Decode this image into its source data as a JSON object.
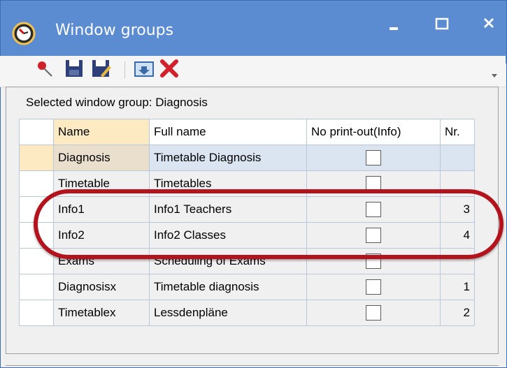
{
  "window": {
    "title": "Window groups",
    "accent_color": "#5b8cd1",
    "controls": {
      "minimize": "minimize-icon",
      "maximize": "maximize-icon",
      "close": "close-icon"
    }
  },
  "toolbar": {
    "buttons": [
      {
        "icon": "pin-icon"
      },
      {
        "icon": "save-icon"
      },
      {
        "icon": "save-as-icon"
      },
      {
        "icon": "move-down-icon"
      },
      {
        "icon": "delete-icon"
      }
    ]
  },
  "selection": {
    "label": "Selected window group: Diagnosis"
  },
  "table": {
    "headers": [
      "Name",
      "Full name",
      "No print-out(Info)",
      "Nr."
    ],
    "rows": [
      {
        "name": "Diagnosis",
        "full_name": "Timetable Diagnosis",
        "no_print": false,
        "nr": ""
      },
      {
        "name": "Timetable",
        "full_name": "Timetables",
        "no_print": false,
        "nr": ""
      },
      {
        "name": "Info1",
        "full_name": "Info1 Teachers",
        "no_print": false,
        "nr": "3"
      },
      {
        "name": "Info2",
        "full_name": "Info2 Classes",
        "no_print": false,
        "nr": "4"
      },
      {
        "name": "Exams",
        "full_name": "Scheduling of Exams",
        "no_print": false,
        "nr": ""
      },
      {
        "name": "Diagnosisx",
        "full_name": "Timetable diagnosis",
        "no_print": false,
        "nr": "1"
      },
      {
        "name": "Timetablex",
        "full_name": "Lessdenpläne",
        "no_print": false,
        "nr": "2"
      }
    ]
  },
  "annotation": {
    "highlight_color": "#b3131c"
  }
}
